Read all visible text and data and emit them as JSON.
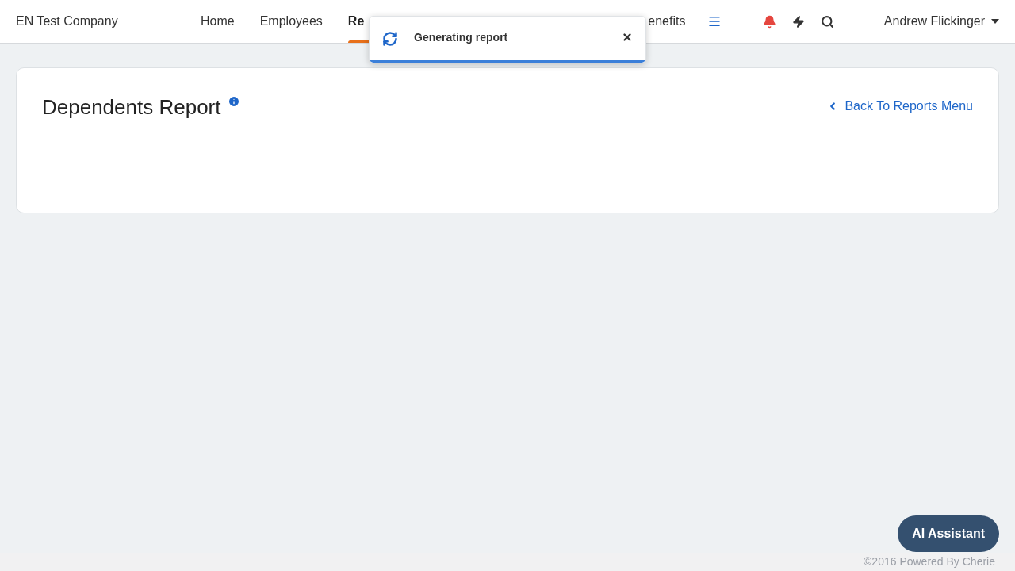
{
  "company": "EN Test Company",
  "nav": [
    {
      "label": "Home",
      "selected": false
    },
    {
      "label": "Employees",
      "selected": false
    },
    {
      "label": "Re",
      "selected": true
    },
    {
      "label": "enefits",
      "selected": false
    }
  ],
  "notifications": {
    "alert": true
  },
  "user": {
    "name": "Andrew Flickinger"
  },
  "toast": {
    "message": "Generating report",
    "level": 1
  },
  "page": {
    "title": "Dependents Report",
    "back_link": "Back To Reports Menu"
  },
  "assistant_button": "AI Assistant",
  "footer": "©2016 Powered By Cherie"
}
